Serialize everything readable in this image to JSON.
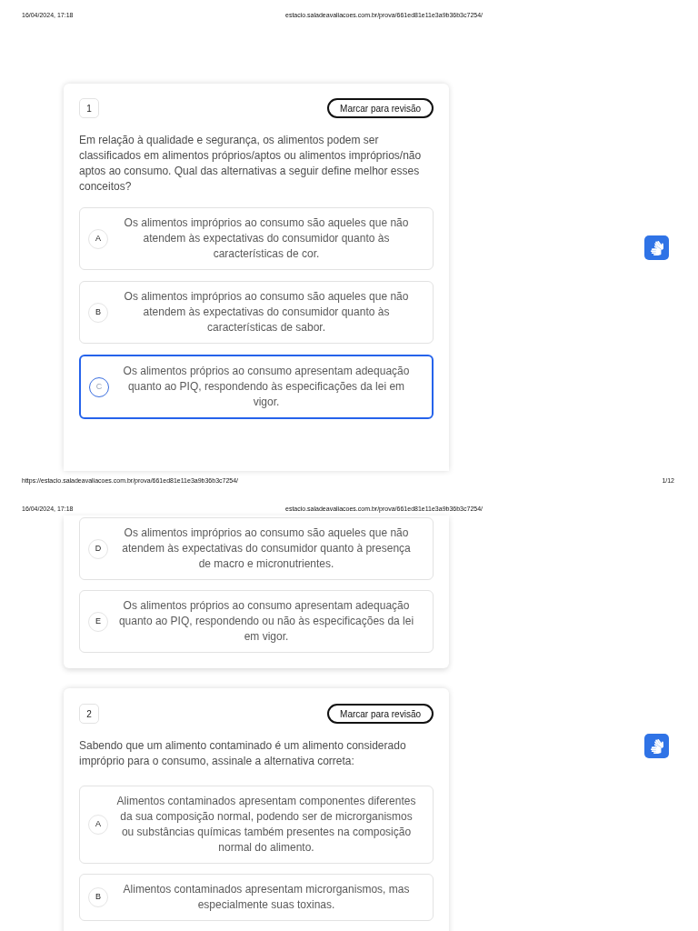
{
  "print_pages": [
    {
      "header_date": "16/04/2024, 17:18",
      "header_url": "estacio.saladeavaliacoes.com.br/prova/661ed81e11e3a9b36b3c7254/",
      "footer_url": "https://estacio.saladeavaliacoes.com.br/prova/661ed81e11e3a9b36b3c7254/",
      "footer_page": "1/12",
      "questions": [
        {
          "number": "1",
          "review_button": "Marcar para revisão",
          "text": "Em relação à qualidade e segurança, os alimentos podem ser classificados em alimentos próprios/aptos ou alimentos impróprios/não aptos ao consumo. Qual das alternativas a seguir define melhor esses conceitos?",
          "options": [
            {
              "letter": "A",
              "text": "Os alimentos impróprios ao consumo são aqueles que não atendem às expectativas do consumidor quanto às características de cor.",
              "selected": false
            },
            {
              "letter": "B",
              "text": "Os alimentos impróprios ao consumo são aqueles que não atendem às expectativas do consumidor quanto às características de sabor.",
              "selected": false
            },
            {
              "letter": "C",
              "text": "Os alimentos próprios ao consumo apresentam adequação quanto ao PIQ, respondendo às especificações da lei em vigor.",
              "selected": true
            }
          ]
        }
      ]
    },
    {
      "header_date": "16/04/2024, 17:18",
      "header_url": "estacio.saladeavaliacoes.com.br/prova/661ed81e11e3a9b36b3c7254/",
      "questions": [
        {
          "options": [
            {
              "letter": "D",
              "text": "Os alimentos impróprios ao consumo são aqueles que não atendem às expectativas do consumidor quanto à presença de macro e micronutrientes.",
              "selected": false
            },
            {
              "letter": "E",
              "text": "Os alimentos próprios ao consumo apresentam adequação quanto ao PIQ, respondendo ou não às especificações da lei em vigor.",
              "selected": false
            }
          ]
        },
        {
          "number": "2",
          "review_button": "Marcar para revisão",
          "text": "Sabendo que um alimento contaminado é um alimento considerado impróprio para o consumo, assinale a alternativa correta:",
          "options": [
            {
              "letter": "A",
              "text": "Alimentos contaminados apresentam componentes diferentes da sua composição normal, podendo ser de microrganismos ou substâncias químicas também presentes na composição normal do alimento.",
              "selected": false
            },
            {
              "letter": "B",
              "text": "Alimentos contaminados apresentam microrganismos, mas especialmente suas toxinas.",
              "selected": false
            }
          ]
        }
      ]
    }
  ]
}
